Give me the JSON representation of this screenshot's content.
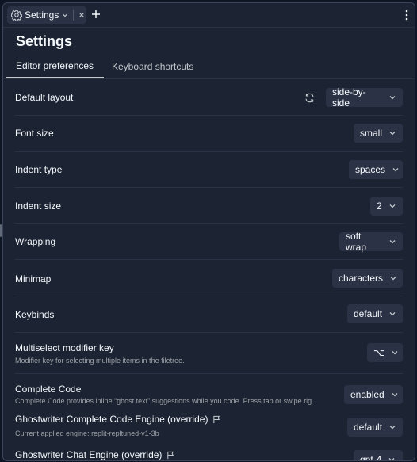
{
  "tab": {
    "label": "Settings"
  },
  "page_title": "Settings",
  "settings_tabs": [
    {
      "label": "Editor preferences",
      "active": true
    },
    {
      "label": "Keyboard shortcuts",
      "active": false
    }
  ],
  "rows": [
    {
      "label": "Default layout",
      "value": "side-by-side"
    },
    {
      "label": "Font size",
      "value": "small"
    },
    {
      "label": "Indent type",
      "value": "spaces"
    },
    {
      "label": "Indent size",
      "value": "2"
    },
    {
      "label": "Wrapping",
      "value": "soft wrap"
    },
    {
      "label": "Minimap",
      "value": "characters"
    },
    {
      "label": "Keybinds",
      "value": "default"
    },
    {
      "label": "Multiselect modifier key",
      "description": "Modifier key for selecting multiple items in the filetree.",
      "value": "⌥"
    },
    {
      "label": "Complete Code",
      "description": "Complete Code provides inline “ghost text” suggestions while you code. Press tab or swipe rig...",
      "value": "enabled"
    },
    {
      "label": "Ghostwriter Complete Code Engine (override)",
      "description": "Current applied engine: replit-repltuned-v1-3b",
      "value": "default"
    },
    {
      "label": "Ghostwriter Chat Engine (override)",
      "value": "gpt-4"
    }
  ],
  "icons": {
    "tab": "gear-icon",
    "tab_dropdown": "chevron-down-icon",
    "tab_close": "close-icon",
    "new_tab": "plus-icon",
    "menu": "kebab-menu-icon",
    "reset_layout": "refresh-icon",
    "feedback": "flag-icon"
  },
  "colors": {
    "background": "#1c2333",
    "surface": "#2b3245",
    "text": "#f5f9fc",
    "muted_text": "#9da2a6"
  }
}
